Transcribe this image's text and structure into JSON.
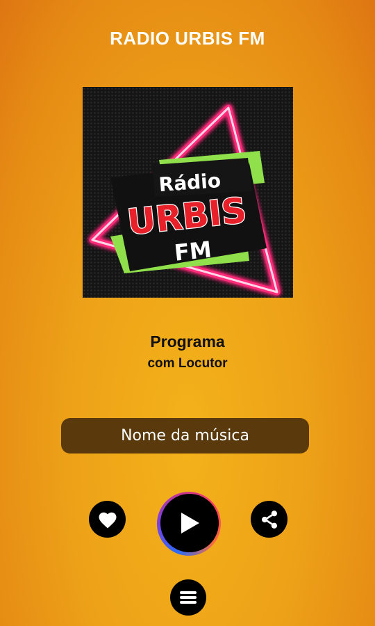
{
  "app": {
    "title": "RADIO URBIS FM"
  },
  "logo": {
    "line1": "Rádio",
    "line2": "URBIS",
    "line3": "FM"
  },
  "program": {
    "title": "Programa",
    "host": "com Locutor"
  },
  "now_playing": {
    "song": "Nome da música"
  },
  "controls": {
    "favorite_icon": "heart-icon",
    "play_icon": "play-icon",
    "share_icon": "share-icon",
    "menu_icon": "menu-icon"
  },
  "colors": {
    "background": "#eda118",
    "song_bar": "#5a3a0c",
    "neon_pink": "#ff2a7a",
    "neon_green": "#8fe04a",
    "logo_red": "#e8202a"
  }
}
